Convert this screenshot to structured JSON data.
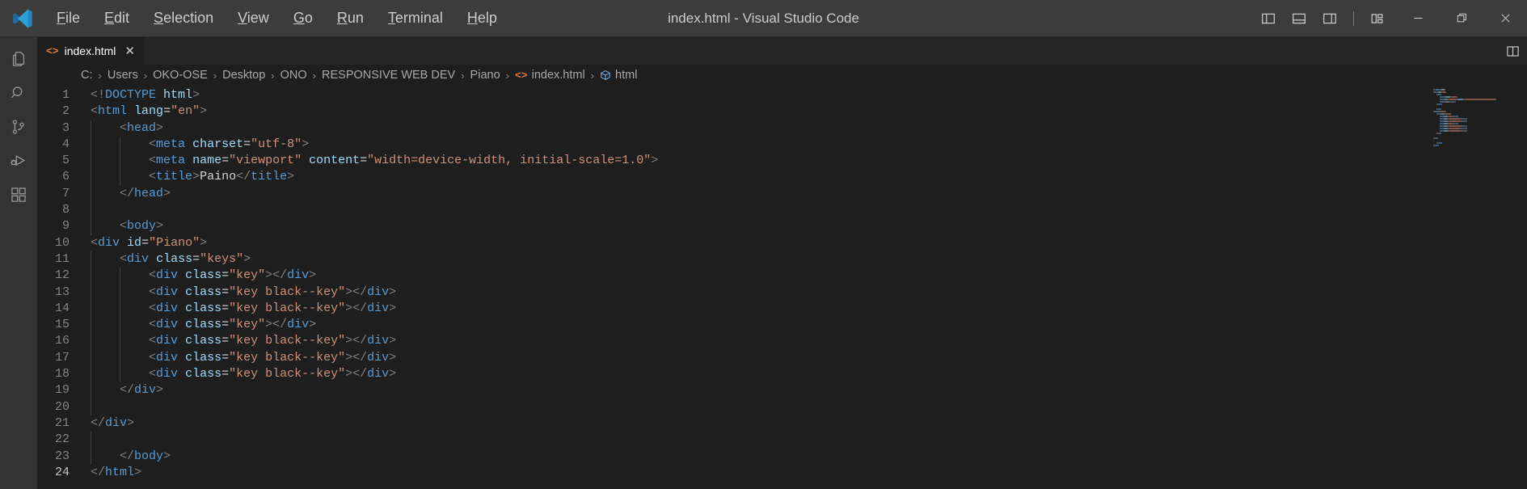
{
  "window": {
    "title": "index.html - Visual Studio Code",
    "logo_icon": "vscode-logo-icon"
  },
  "menubar": {
    "items": [
      {
        "label": "File",
        "mnemonic": "F"
      },
      {
        "label": "Edit",
        "mnemonic": "E"
      },
      {
        "label": "Selection",
        "mnemonic": "S"
      },
      {
        "label": "View",
        "mnemonic": "V"
      },
      {
        "label": "Go",
        "mnemonic": "G"
      },
      {
        "label": "Run",
        "mnemonic": "R"
      },
      {
        "label": "Terminal",
        "mnemonic": "T"
      },
      {
        "label": "Help",
        "mnemonic": "H"
      }
    ]
  },
  "title_actions": {
    "layout_icons": [
      {
        "name": "toggle-primary-sidebar-icon",
        "tooltip": "Toggle Primary Side Bar"
      },
      {
        "name": "toggle-panel-icon",
        "tooltip": "Toggle Panel"
      },
      {
        "name": "toggle-secondary-sidebar-icon",
        "tooltip": "Toggle Secondary Side Bar"
      },
      {
        "name": "customize-layout-icon",
        "tooltip": "Customize Layout"
      }
    ],
    "window_controls": [
      {
        "name": "minimize-button",
        "glyph": "minimize"
      },
      {
        "name": "restore-button",
        "glyph": "restore"
      },
      {
        "name": "close-button",
        "glyph": "close"
      }
    ]
  },
  "activitybar": {
    "items": [
      {
        "name": "sidebar-item-explorer",
        "label": "Explorer",
        "icon": "files-icon"
      },
      {
        "name": "sidebar-item-search",
        "label": "Search",
        "icon": "search-icon"
      },
      {
        "name": "sidebar-item-source-control",
        "label": "Source Control",
        "icon": "source-control-icon"
      },
      {
        "name": "sidebar-item-run-debug",
        "label": "Run and Debug",
        "icon": "run-debug-icon"
      },
      {
        "name": "sidebar-item-extensions",
        "label": "Extensions",
        "icon": "extensions-icon"
      }
    ]
  },
  "tabs": [
    {
      "label": "index.html",
      "icon": "html-file-icon",
      "close_glyph": "✕",
      "active": true
    }
  ],
  "editor_actions": {
    "split_editor": "split-editor-right-icon"
  },
  "breadcrumbs": {
    "segments": [
      {
        "label": "C:",
        "icon": null
      },
      {
        "label": "Users",
        "icon": null
      },
      {
        "label": "OKO-OSE",
        "icon": null
      },
      {
        "label": "Desktop",
        "icon": null
      },
      {
        "label": "ONO",
        "icon": null
      },
      {
        "label": "RESPONSIVE WEB DEV",
        "icon": null
      },
      {
        "label": "Piano",
        "icon": null
      },
      {
        "label": "index.html",
        "icon": "html-file-icon"
      },
      {
        "label": "html",
        "icon": "symbol-tag-icon"
      }
    ],
    "separator": "›"
  },
  "editor": {
    "language": "html",
    "active_line": 24,
    "total_lines": 24,
    "lines": [
      {
        "n": 1,
        "indent": 0,
        "tokens": [
          {
            "t": "<!",
            "c": "t-brk"
          },
          {
            "t": "DOCTYPE",
            "c": "t-tag"
          },
          {
            "t": " ",
            "c": "t-txt"
          },
          {
            "t": "html",
            "c": "t-attr"
          },
          {
            "t": ">",
            "c": "t-brk"
          }
        ]
      },
      {
        "n": 2,
        "indent": 0,
        "tokens": [
          {
            "t": "<",
            "c": "t-brk"
          },
          {
            "t": "html",
            "c": "t-tag"
          },
          {
            "t": " ",
            "c": "t-txt"
          },
          {
            "t": "lang",
            "c": "t-attr"
          },
          {
            "t": "=",
            "c": "t-eq"
          },
          {
            "t": "\"en\"",
            "c": "t-str"
          },
          {
            "t": ">",
            "c": "t-brk"
          }
        ]
      },
      {
        "n": 3,
        "indent": 1,
        "tokens": [
          {
            "t": "<",
            "c": "t-brk"
          },
          {
            "t": "head",
            "c": "t-tag"
          },
          {
            "t": ">",
            "c": "t-brk"
          }
        ]
      },
      {
        "n": 4,
        "indent": 2,
        "tokens": [
          {
            "t": "<",
            "c": "t-brk"
          },
          {
            "t": "meta",
            "c": "t-tag"
          },
          {
            "t": " ",
            "c": "t-txt"
          },
          {
            "t": "charset",
            "c": "t-attr"
          },
          {
            "t": "=",
            "c": "t-eq"
          },
          {
            "t": "\"utf-8\"",
            "c": "t-str"
          },
          {
            "t": ">",
            "c": "t-brk"
          }
        ]
      },
      {
        "n": 5,
        "indent": 2,
        "tokens": [
          {
            "t": "<",
            "c": "t-brk"
          },
          {
            "t": "meta",
            "c": "t-tag"
          },
          {
            "t": " ",
            "c": "t-txt"
          },
          {
            "t": "name",
            "c": "t-attr"
          },
          {
            "t": "=",
            "c": "t-eq"
          },
          {
            "t": "\"viewport\"",
            "c": "t-str"
          },
          {
            "t": " ",
            "c": "t-txt"
          },
          {
            "t": "content",
            "c": "t-attr"
          },
          {
            "t": "=",
            "c": "t-eq"
          },
          {
            "t": "\"width=device-width, initial-scale=1.0\"",
            "c": "t-str"
          },
          {
            "t": ">",
            "c": "t-brk"
          }
        ]
      },
      {
        "n": 6,
        "indent": 2,
        "tokens": [
          {
            "t": "<",
            "c": "t-brk"
          },
          {
            "t": "title",
            "c": "t-tag"
          },
          {
            "t": ">",
            "c": "t-brk"
          },
          {
            "t": "Paino",
            "c": "t-txt"
          },
          {
            "t": "</",
            "c": "t-brk"
          },
          {
            "t": "title",
            "c": "t-tag"
          },
          {
            "t": ">",
            "c": "t-brk"
          }
        ]
      },
      {
        "n": 7,
        "indent": 1,
        "tokens": [
          {
            "t": "</",
            "c": "t-brk"
          },
          {
            "t": "head",
            "c": "t-tag"
          },
          {
            "t": ">",
            "c": "t-brk"
          }
        ]
      },
      {
        "n": 8,
        "indent": 1,
        "tokens": []
      },
      {
        "n": 9,
        "indent": 1,
        "tokens": [
          {
            "t": "<",
            "c": "t-brk"
          },
          {
            "t": "body",
            "c": "t-tag"
          },
          {
            "t": ">",
            "c": "t-brk"
          }
        ]
      },
      {
        "n": 10,
        "indent": 0,
        "tokens": [
          {
            "t": "<",
            "c": "t-brk"
          },
          {
            "t": "div",
            "c": "t-tag"
          },
          {
            "t": " ",
            "c": "t-txt"
          },
          {
            "t": "id",
            "c": "t-attr"
          },
          {
            "t": "=",
            "c": "t-eq"
          },
          {
            "t": "\"Piano\"",
            "c": "t-str"
          },
          {
            "t": ">",
            "c": "t-brk"
          }
        ]
      },
      {
        "n": 11,
        "indent": 1,
        "tokens": [
          {
            "t": "<",
            "c": "t-brk"
          },
          {
            "t": "div",
            "c": "t-tag"
          },
          {
            "t": " ",
            "c": "t-txt"
          },
          {
            "t": "class",
            "c": "t-attr"
          },
          {
            "t": "=",
            "c": "t-eq"
          },
          {
            "t": "\"keys\"",
            "c": "t-str"
          },
          {
            "t": ">",
            "c": "t-brk"
          }
        ]
      },
      {
        "n": 12,
        "indent": 2,
        "tokens": [
          {
            "t": "<",
            "c": "t-brk"
          },
          {
            "t": "div",
            "c": "t-tag"
          },
          {
            "t": " ",
            "c": "t-txt"
          },
          {
            "t": "class",
            "c": "t-attr"
          },
          {
            "t": "=",
            "c": "t-eq"
          },
          {
            "t": "\"key\"",
            "c": "t-str"
          },
          {
            "t": ">",
            "c": "t-brk"
          },
          {
            "t": "</",
            "c": "t-brk"
          },
          {
            "t": "div",
            "c": "t-tag"
          },
          {
            "t": ">",
            "c": "t-brk"
          }
        ]
      },
      {
        "n": 13,
        "indent": 2,
        "tokens": [
          {
            "t": "<",
            "c": "t-brk"
          },
          {
            "t": "div",
            "c": "t-tag"
          },
          {
            "t": " ",
            "c": "t-txt"
          },
          {
            "t": "class",
            "c": "t-attr"
          },
          {
            "t": "=",
            "c": "t-eq"
          },
          {
            "t": "\"key black--key\"",
            "c": "t-str"
          },
          {
            "t": ">",
            "c": "t-brk"
          },
          {
            "t": "</",
            "c": "t-brk"
          },
          {
            "t": "div",
            "c": "t-tag"
          },
          {
            "t": ">",
            "c": "t-brk"
          }
        ]
      },
      {
        "n": 14,
        "indent": 2,
        "tokens": [
          {
            "t": "<",
            "c": "t-brk"
          },
          {
            "t": "div",
            "c": "t-tag"
          },
          {
            "t": " ",
            "c": "t-txt"
          },
          {
            "t": "class",
            "c": "t-attr"
          },
          {
            "t": "=",
            "c": "t-eq"
          },
          {
            "t": "\"key black--key\"",
            "c": "t-str"
          },
          {
            "t": ">",
            "c": "t-brk"
          },
          {
            "t": "</",
            "c": "t-brk"
          },
          {
            "t": "div",
            "c": "t-tag"
          },
          {
            "t": ">",
            "c": "t-brk"
          }
        ]
      },
      {
        "n": 15,
        "indent": 2,
        "tokens": [
          {
            "t": "<",
            "c": "t-brk"
          },
          {
            "t": "div",
            "c": "t-tag"
          },
          {
            "t": " ",
            "c": "t-txt"
          },
          {
            "t": "class",
            "c": "t-attr"
          },
          {
            "t": "=",
            "c": "t-eq"
          },
          {
            "t": "\"key\"",
            "c": "t-str"
          },
          {
            "t": ">",
            "c": "t-brk"
          },
          {
            "t": "</",
            "c": "t-brk"
          },
          {
            "t": "div",
            "c": "t-tag"
          },
          {
            "t": ">",
            "c": "t-brk"
          }
        ]
      },
      {
        "n": 16,
        "indent": 2,
        "tokens": [
          {
            "t": "<",
            "c": "t-brk"
          },
          {
            "t": "div",
            "c": "t-tag"
          },
          {
            "t": " ",
            "c": "t-txt"
          },
          {
            "t": "class",
            "c": "t-attr"
          },
          {
            "t": "=",
            "c": "t-eq"
          },
          {
            "t": "\"key black--key\"",
            "c": "t-str"
          },
          {
            "t": ">",
            "c": "t-brk"
          },
          {
            "t": "</",
            "c": "t-brk"
          },
          {
            "t": "div",
            "c": "t-tag"
          },
          {
            "t": ">",
            "c": "t-brk"
          }
        ]
      },
      {
        "n": 17,
        "indent": 2,
        "tokens": [
          {
            "t": "<",
            "c": "t-brk"
          },
          {
            "t": "div",
            "c": "t-tag"
          },
          {
            "t": " ",
            "c": "t-txt"
          },
          {
            "t": "class",
            "c": "t-attr"
          },
          {
            "t": "=",
            "c": "t-eq"
          },
          {
            "t": "\"key black--key\"",
            "c": "t-str"
          },
          {
            "t": ">",
            "c": "t-brk"
          },
          {
            "t": "</",
            "c": "t-brk"
          },
          {
            "t": "div",
            "c": "t-tag"
          },
          {
            "t": ">",
            "c": "t-brk"
          }
        ]
      },
      {
        "n": 18,
        "indent": 2,
        "tokens": [
          {
            "t": "<",
            "c": "t-brk"
          },
          {
            "t": "div",
            "c": "t-tag"
          },
          {
            "t": " ",
            "c": "t-txt"
          },
          {
            "t": "class",
            "c": "t-attr"
          },
          {
            "t": "=",
            "c": "t-eq"
          },
          {
            "t": "\"key black--key\"",
            "c": "t-str"
          },
          {
            "t": ">",
            "c": "t-brk"
          },
          {
            "t": "</",
            "c": "t-brk"
          },
          {
            "t": "div",
            "c": "t-tag"
          },
          {
            "t": ">",
            "c": "t-brk"
          }
        ]
      },
      {
        "n": 19,
        "indent": 1,
        "tokens": [
          {
            "t": "</",
            "c": "t-brk"
          },
          {
            "t": "div",
            "c": "t-tag"
          },
          {
            "t": ">",
            "c": "t-brk"
          }
        ]
      },
      {
        "n": 20,
        "indent": 1,
        "tokens": []
      },
      {
        "n": 21,
        "indent": 0,
        "tokens": [
          {
            "t": "</",
            "c": "t-brk"
          },
          {
            "t": "div",
            "c": "t-tag"
          },
          {
            "t": ">",
            "c": "t-brk"
          }
        ]
      },
      {
        "n": 22,
        "indent": 1,
        "tokens": []
      },
      {
        "n": 23,
        "indent": 1,
        "tokens": [
          {
            "t": "</",
            "c": "t-brk"
          },
          {
            "t": "body",
            "c": "t-tag"
          },
          {
            "t": ">",
            "c": "t-brk"
          }
        ]
      },
      {
        "n": 24,
        "indent": 0,
        "tokens": [
          {
            "t": "</",
            "c": "t-brk"
          },
          {
            "t": "html",
            "c": "t-tag"
          },
          {
            "t": ">",
            "c": "t-brk"
          }
        ]
      }
    ]
  },
  "colors": {
    "titlebar_bg": "#3c3c3c",
    "activitybar_bg": "#333333",
    "editor_bg": "#1e1e1e",
    "tabbar_bg": "#252526",
    "tag": "#569cd6",
    "attribute": "#9cdcfe",
    "string": "#ce9178",
    "text": "#d4d4d4",
    "line_number": "#858585",
    "html_icon": "#e37933"
  }
}
